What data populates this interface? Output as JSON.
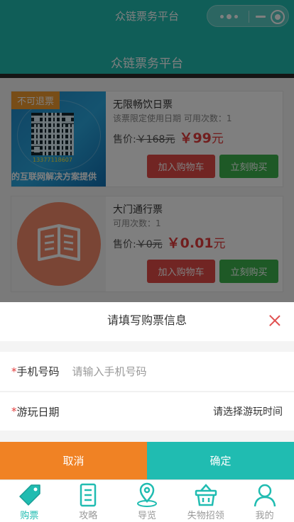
{
  "app": {
    "title": "众链票务平台"
  },
  "header": {
    "title": "众链票务平台"
  },
  "products": [
    {
      "tag": "不可退票",
      "thumb_number": "13377118607",
      "thumb_caption": "的互联网解决方案提供",
      "name": "无限畅饮日票",
      "desc": "该票限定使用日期 可用次数：1",
      "price_label": "售价:",
      "old_price": "￥168元",
      "new_price": "￥99",
      "unit": "元",
      "cart_label": "加入购物车",
      "buy_label": "立刻购买"
    },
    {
      "name": "大门通行票",
      "desc": "可用次数：1",
      "price_label": "售价:",
      "old_price": "￥0元",
      "new_price": "￥0.01",
      "unit": "元",
      "cart_label": "加入购物车",
      "buy_label": "立刻购买"
    }
  ],
  "modal": {
    "title": "请填写购票信息",
    "phone": {
      "required_mark": "*",
      "label": "手机号码",
      "placeholder": "请输入手机号码",
      "value": ""
    },
    "date": {
      "required_mark": "*",
      "label": "游玩日期",
      "placeholder": "请选择游玩时间"
    },
    "cancel_label": "取消",
    "confirm_label": "确定"
  },
  "tabbar": {
    "items": [
      {
        "label": "购票",
        "icon": "ticket-icon",
        "active": true
      },
      {
        "label": "攻略",
        "icon": "document-icon",
        "active": false
      },
      {
        "label": "导览",
        "icon": "map-pin-icon",
        "active": false
      },
      {
        "label": "失物招领",
        "icon": "basket-icon",
        "active": false
      },
      {
        "label": "我的",
        "icon": "user-icon",
        "active": false
      }
    ]
  },
  "colors": {
    "primary": "#20bcb1",
    "accent_orange": "#f08224",
    "price_red": "#e23c3c",
    "cart_red": "#e34a46",
    "buy_green": "#3cb24c",
    "tag_orange": "#f09a2e"
  }
}
